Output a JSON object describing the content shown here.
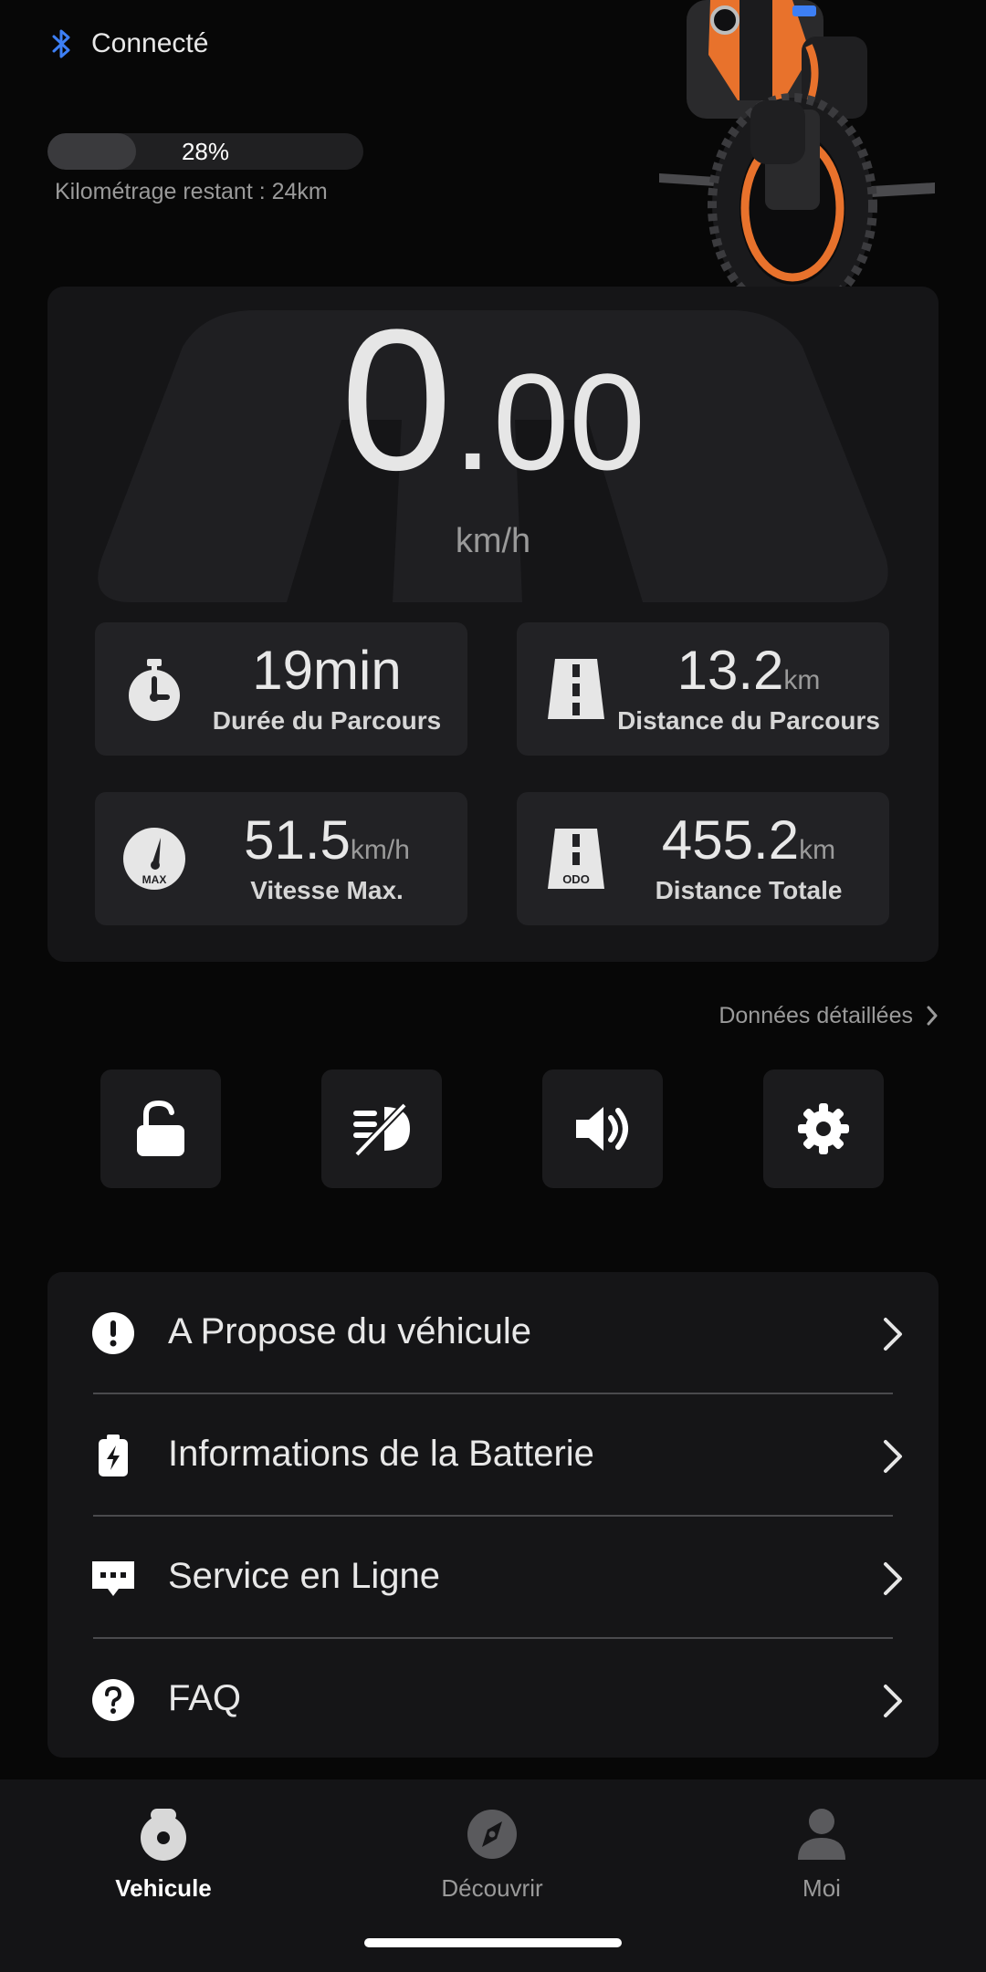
{
  "status": {
    "connection": "Connecté",
    "battery_level": 0.28,
    "battery_percent": "28%",
    "range_text": "Kilométrage restant : 24km"
  },
  "speed": {
    "integer": "0",
    "decimal": "00",
    "unit": "km/h"
  },
  "stats": [
    {
      "value": "19min",
      "unit": "",
      "label": "Durée du Parcours",
      "icon": "stopwatch-icon"
    },
    {
      "value": "13.2",
      "unit": "km",
      "label": "Distance du Parcours",
      "icon": "road-icon"
    },
    {
      "value": "51.5",
      "unit": "km/h",
      "label": "Vitesse Max.",
      "icon": "speedometer-max-icon"
    },
    {
      "value": "455.2",
      "unit": "km",
      "label": "Distance Totale",
      "icon": "odometer-road-icon"
    }
  ],
  "odo_badge": "ODO",
  "max_badge": "MAX",
  "details_link": "Données détaillées",
  "quick_actions": [
    "unlock-icon",
    "light-off-icon",
    "volume-icon",
    "gear-icon"
  ],
  "menu": [
    {
      "label": "A Propose du véhicule",
      "icon": "info-icon"
    },
    {
      "label": "Informations de la Batterie",
      "icon": "battery-icon"
    },
    {
      "label": "Service en Ligne",
      "icon": "chat-icon"
    },
    {
      "label": "FAQ",
      "icon": "question-icon"
    }
  ],
  "nav": [
    {
      "label": "Vehicule",
      "icon": "wheel-icon",
      "active": true
    },
    {
      "label": "Découvrir",
      "icon": "compass-icon",
      "active": false
    },
    {
      "label": "Moi",
      "icon": "person-icon",
      "active": false
    }
  ],
  "colors": {
    "background": "#070707",
    "card": "#151517",
    "tile": "#222225",
    "accent_orange": "#e8722c",
    "bluetooth": "#3d7ff5"
  }
}
